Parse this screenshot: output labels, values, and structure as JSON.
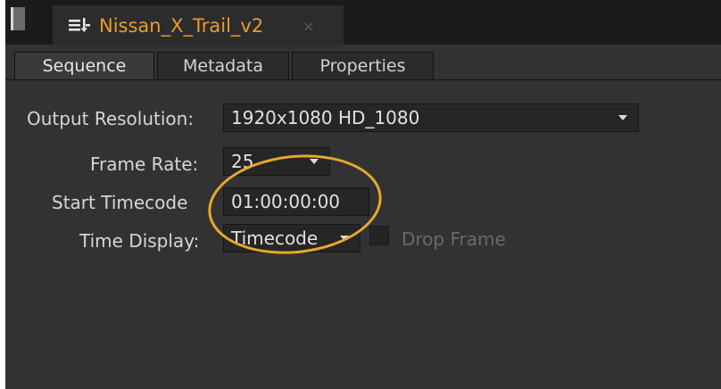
{
  "window": {
    "title": "Nissan_X_Trail_v2",
    "close_glyph": "×"
  },
  "tabs": [
    {
      "label": "Sequence",
      "active": true
    },
    {
      "label": "Metadata",
      "active": false
    },
    {
      "label": "Properties",
      "active": false
    }
  ],
  "form": {
    "output_resolution": {
      "label": "Output Resolution:",
      "value": "1920x1080 HD_1080"
    },
    "frame_rate": {
      "label": "Frame Rate:",
      "value": "25"
    },
    "start_timecode": {
      "label": "Start Timecode",
      "value": "01:00:00:00"
    },
    "time_display": {
      "label": "Time Display:",
      "value": "Timecode"
    },
    "drop_frame": {
      "label": "Drop Frame",
      "checked": false,
      "enabled": false
    }
  },
  "icons": {
    "panel_handle": "panel-dock-handle-icon",
    "title_icon": "sequence-list-icon",
    "close_icon": "close-icon",
    "dropdown_icon": "chevron-down-icon"
  },
  "colors": {
    "accent": "#e89b2c",
    "panel_bg": "#323232",
    "field_bg": "#262626"
  }
}
